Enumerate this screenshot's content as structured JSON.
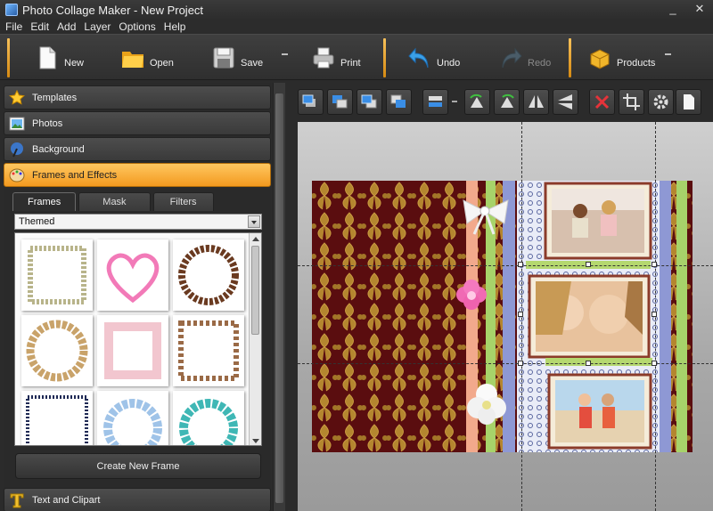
{
  "window": {
    "title": "Photo Collage Maker - New Project",
    "minimize": "_",
    "close": "✕"
  },
  "menu": [
    "File",
    "Edit",
    "Add",
    "Layer",
    "Options",
    "Help"
  ],
  "toolbar": {
    "new": "New",
    "open": "Open",
    "save": "Save",
    "print": "Print",
    "undo": "Undo",
    "redo": "Redo",
    "products": "Products"
  },
  "panel": {
    "sections": {
      "templates": "Templates",
      "photos": "Photos",
      "background": "Background",
      "frames": "Frames and Effects",
      "text": "Text and Clipart"
    },
    "tabs": [
      "Frames",
      "Mask",
      "Filters"
    ],
    "category": "Themed",
    "create_button": "Create New Frame"
  },
  "colors": {
    "accent": "#f5a623",
    "canvas_bg": "#5b0e0e"
  }
}
